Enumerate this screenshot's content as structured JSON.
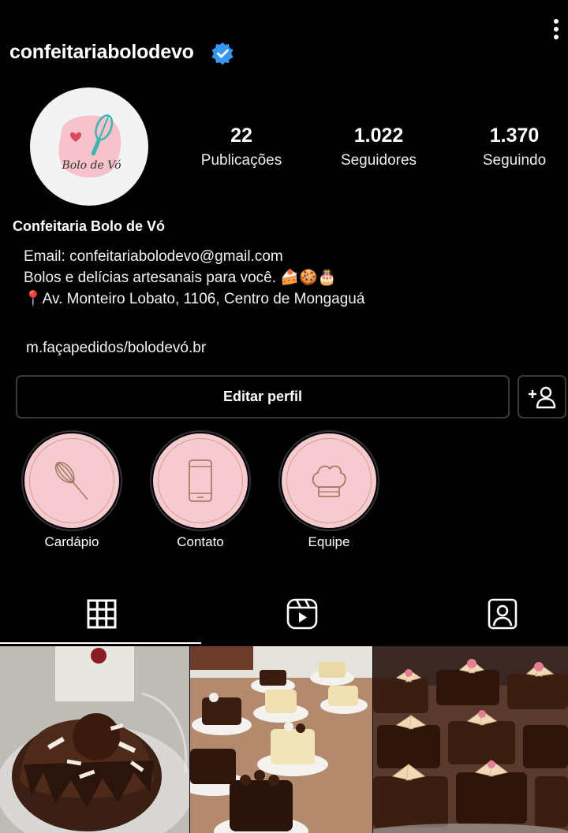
{
  "header": {
    "username": "confeitariabolodevo",
    "verified_color": "#3897f0",
    "more_icon": "more-vertical-icon"
  },
  "profile": {
    "avatar_text": "Bolo de Vó",
    "stats": [
      {
        "value": "22",
        "label": "Publicações"
      },
      {
        "value": "1.022",
        "label": "Seguidores"
      },
      {
        "value": "1.370",
        "label": "Seguindo"
      }
    ],
    "full_name": "Confeitaria Bolo de Vó",
    "bio": [
      "Email: confeitariabolodevo@gmail.com",
      "Bolos e delícias artesanais para você. 🍰🍪🎂",
      "📍Av. Monteiro Lobato, 1106, Centro de Mongaguá"
    ],
    "link": "m.façapedidos/bolodevó.br"
  },
  "actions": {
    "edit_label": "Editar perfil",
    "add_icon": "add-person-icon"
  },
  "highlights": [
    {
      "label": "Cardápio",
      "icon": "whisk-icon"
    },
    {
      "label": "Contato",
      "icon": "phone-icon"
    },
    {
      "label": "Equipe",
      "icon": "chef-hat-icon"
    }
  ],
  "tabs": [
    {
      "icon": "grid-icon",
      "active": true
    },
    {
      "icon": "reels-icon",
      "active": false
    },
    {
      "icon": "tagged-icon",
      "active": false
    }
  ],
  "colors": {
    "background": "#000000",
    "highlight_pink": "#f7c9d1",
    "highlight_line": "#c9a58a",
    "border": "#3a3a3a"
  }
}
